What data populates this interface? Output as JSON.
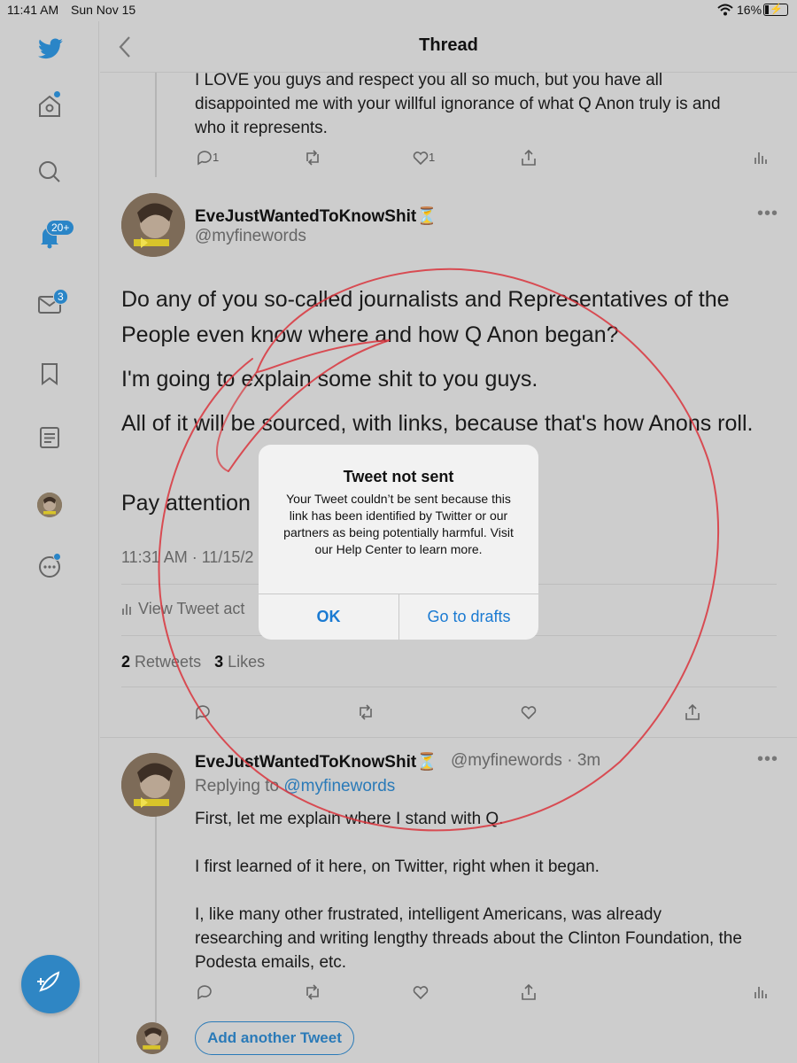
{
  "status_bar": {
    "time": "11:41 AM",
    "date": "Sun Nov 15",
    "battery": "16%",
    "battery_level": 0.16
  },
  "sidebar": {
    "notifications_badge": "20+",
    "messages_badge": "3"
  },
  "header": {
    "title": "Thread"
  },
  "prev_tweet": {
    "text_lines": [
      "I LOVE you guys and respect you all so much, but you have all",
      "disappointed me with your willful ignorance of what Q Anon truly is and",
      "who it represents."
    ],
    "reply_count": "1",
    "like_count": "1"
  },
  "main_tweet": {
    "display_name": "EveJustWantedToKnowShit",
    "emoji": "⏳",
    "handle": "@myfinewords",
    "paragraphs": [
      "Do any of you so-called journalists and Representatives of the People even know where and how Q Anon began?",
      "I'm going to explain some shit to you guys.",
      "All of it will be sourced, with links, because that's how Anons roll.",
      "Pay attention"
    ],
    "timestamp": "11:31 AM · 11/15/2",
    "view_activity": "View Tweet act",
    "retweets_count": "2",
    "retweets_label": "Retweets",
    "likes_count": "3",
    "likes_label": "Likes"
  },
  "reply_tweet": {
    "display_name": "EveJustWantedToKnowShit",
    "emoji": "⏳",
    "handle_time": "@myfinewords · 3m",
    "replying_prefix": "Replying to",
    "replying_handle": "@myfinewords",
    "lines": [
      "First, let me explain where I stand with Q.",
      "",
      "I first learned of it here, on Twitter, right when it began.",
      "",
      "I, like many other frustrated, intelligent Americans, was already",
      "researching and writing lengthy threads about the Clinton Foundation, the",
      "Podesta emails, etc."
    ]
  },
  "add_tweet_label": "Add another Tweet",
  "alert": {
    "title": "Tweet not sent",
    "message": "Your Tweet couldn’t be sent because this link has been identified by Twitter or our partners as being potentially harmful. Visit our Help Center to learn more.",
    "ok_label": "OK",
    "drafts_label": "Go to drafts"
  },
  "colors": {
    "accent": "#1a7ad2",
    "twitter_blue": "#2a85c7",
    "annotation_red": "#d9343c"
  }
}
